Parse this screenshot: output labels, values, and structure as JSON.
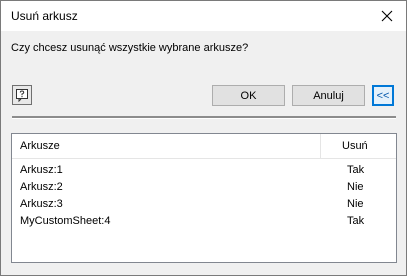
{
  "window": {
    "title": "Usuń arkusz"
  },
  "prompt": "Czy chcesz usunąć wszystkie wybrane arkusze?",
  "buttons": {
    "ok": "OK",
    "cancel": "Anuluj",
    "collapse": "<<"
  },
  "table": {
    "columns": [
      "Arkusze",
      "Usuń"
    ],
    "rows": [
      {
        "name": "Arkusz:1",
        "delete": "Tak"
      },
      {
        "name": "Arkusz:2",
        "delete": "Nie"
      },
      {
        "name": "Arkusz:3",
        "delete": "Nie"
      },
      {
        "name": "MyCustomSheet:4",
        "delete": "Tak"
      }
    ]
  },
  "icons": {
    "close": "close-icon",
    "help": "help-icon"
  },
  "colors": {
    "accent": "#0078d7"
  }
}
